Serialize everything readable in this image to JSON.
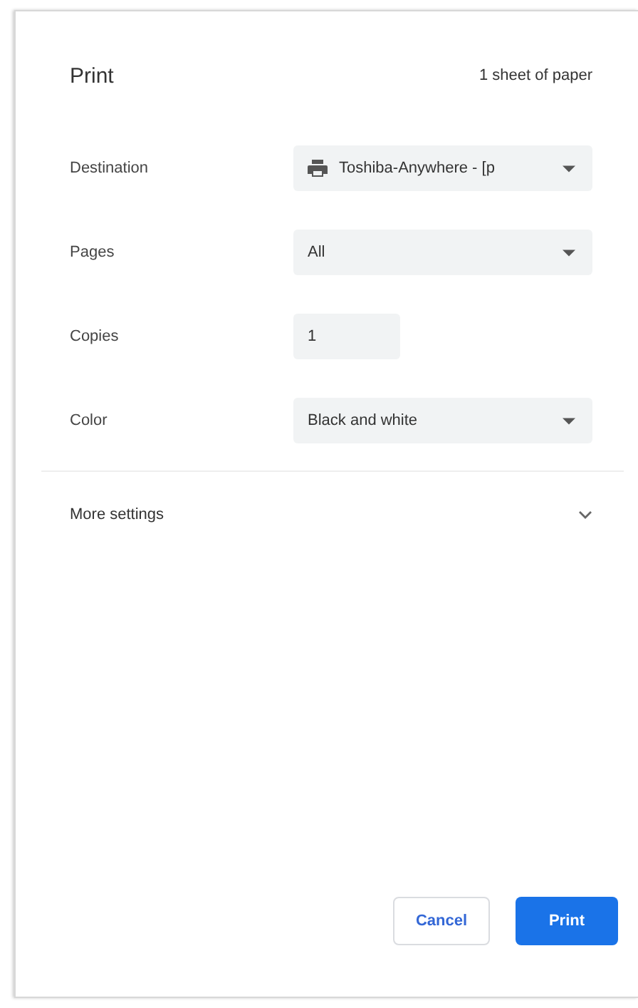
{
  "title": "Print",
  "sheet_count": "1 sheet of paper",
  "settings": [
    {
      "label": "Destination",
      "kind": "destination",
      "value": "Toshiba-Anywhere - [p"
    },
    {
      "label": "Pages",
      "kind": "select",
      "value": "All"
    },
    {
      "label": "Copies",
      "kind": "input",
      "value": "1"
    },
    {
      "label": "Color",
      "kind": "select",
      "value": "Black and white"
    }
  ],
  "more_settings": {
    "label": "More settings",
    "expanded": false
  },
  "buttons": [
    {
      "label": "Cancel",
      "kind": "secondary"
    },
    {
      "label": "Print",
      "kind": "primary"
    }
  ]
}
